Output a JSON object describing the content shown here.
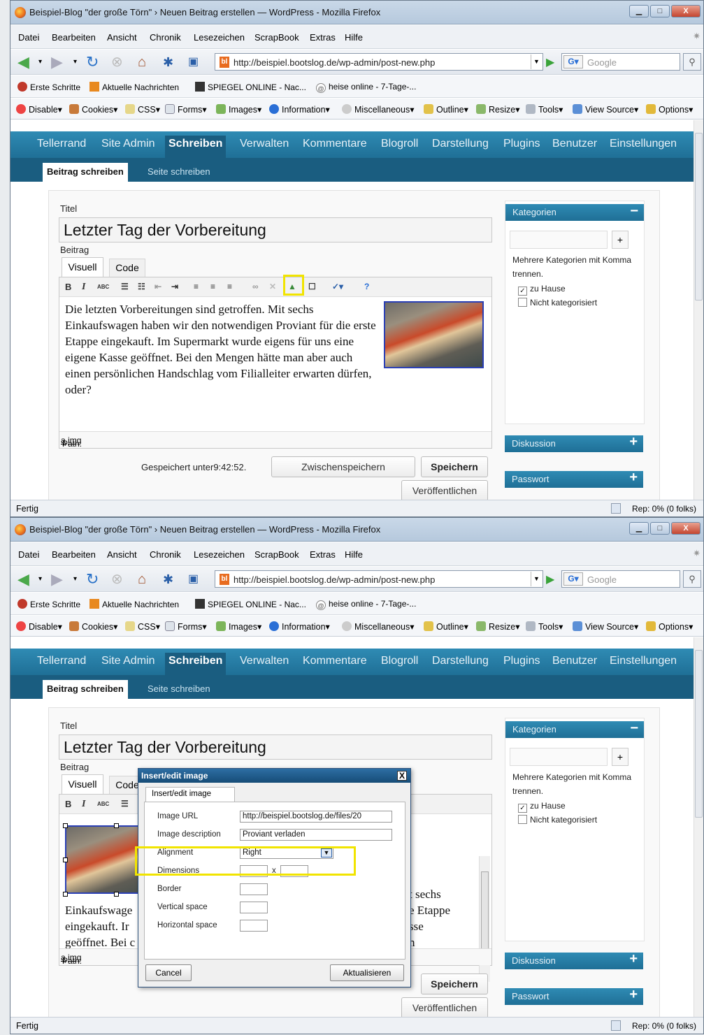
{
  "window": {
    "title": "Beispiel-Blog \"der große Törn\" › Neuen Beitrag erstellen — WordPress - Mozilla Firefox",
    "min": "▁",
    "max": "□",
    "close": "X"
  },
  "menu": [
    "Datei",
    "Bearbeiten",
    "Ansicht",
    "Chronik",
    "Lesezeichen",
    "ScrapBook",
    "Extras",
    "Hilfe"
  ],
  "nav": {
    "url": "http://beispiel.bootslog.de/wp-admin/post-new.php",
    "search_placeholder": "Google",
    "url_icon": "bl"
  },
  "bookmarks": [
    "Erste Schritte",
    "Aktuelle Nachrichten",
    "SPIEGEL ONLINE - Nac...",
    "heise online - 7-Tage-..."
  ],
  "webdev": [
    "Disable▾",
    "Cookies▾",
    "CSS▾",
    "Forms▾",
    "Images▾",
    "Information▾",
    "Miscellaneous▾",
    "Outline▾",
    "Resize▾",
    "Tools▾",
    "View Source▾",
    "Options▾"
  ],
  "wp": {
    "menu": [
      "Tellerrand",
      "Site Admin",
      "Schreiben",
      "Verwalten",
      "Kommentare",
      "Blogroll",
      "Darstellung",
      "Plugins",
      "Benutzer",
      "Einstellungen"
    ],
    "submenu_active": "Beitrag schreiben",
    "submenu_other": "Seite schreiben",
    "title_label": "Titel",
    "title_value": "Letzter Tag der Vorbereitung",
    "body_label": "Beitrag",
    "tab_visual": "Visuell",
    "tab_code": "Code",
    "body_text": "Die letzten Vorbereitungen sind getroffen. Mit sechs Einkaufswagen haben wir den notwendigen Proviant für die erste Etappe eingekauft. Im Supermarkt wurde eigens für uns eine eigene Kasse geöffnet. Bei den Mengen hätte man aber auch einen persönlichen Handschlag vom Filialleiter erwarten dürfen, oder?",
    "path_prefix": "Path:",
    "path_a": "a",
    "path_sep": "»",
    "path_img": "img",
    "saved": "Gespeichert unter9:42:52.",
    "btn_draft": "Zwischenspeichern",
    "btn_save": "Speichern",
    "btn_publish": "Veröffentlichen",
    "side_categories": "Kategorien",
    "side_categories_toggle": "−",
    "side_add": "+",
    "side_hint": "Mehrere Kategorien mit Komma trennen.",
    "cat_home": "zu Hause",
    "cat_home_check": "✓",
    "cat_none": "Nicht kategorisiert",
    "side_discussion": "Diskussion",
    "side_password": "Passwort",
    "side_expand": "+",
    "toolbar": {
      "bold": "B",
      "italic": "I",
      "abc": "ABC",
      "help": "?"
    }
  },
  "second": {
    "text_line1_right": "t sechs",
    "text_line2_left": "Einkaufswage",
    "text_line2_right": "e Etappe",
    "text_line3_left": "eingekauft. Ir",
    "text_line3_right": "sse",
    "text_line4_left": "geöffnet. Bei c",
    "text_line4_right": "n",
    "text_line5_left": "H   d  l  l  l"
  },
  "dialog": {
    "title": "Insert/edit image",
    "close": "X",
    "tab": "Insert/edit image",
    "url_label": "Image URL",
    "url_value": "http://beispiel.bootslog.de/files/20",
    "desc_label": "Image description",
    "desc_value": "Proviant verladen",
    "align_label": "Alignment",
    "align_value": "Right",
    "dims_label": "Dimensions",
    "dims_x": "x",
    "border_label": "Border",
    "vspace_label": "Vertical space",
    "hspace_label": "Horizontal space",
    "cancel": "Cancel",
    "update": "Aktualisieren"
  },
  "status": {
    "left": "Fertig",
    "right": "Rep: 0% (0 folks)"
  },
  "colors": {
    "wp_nav": "#2583ad",
    "highlight": "#f1e400"
  }
}
